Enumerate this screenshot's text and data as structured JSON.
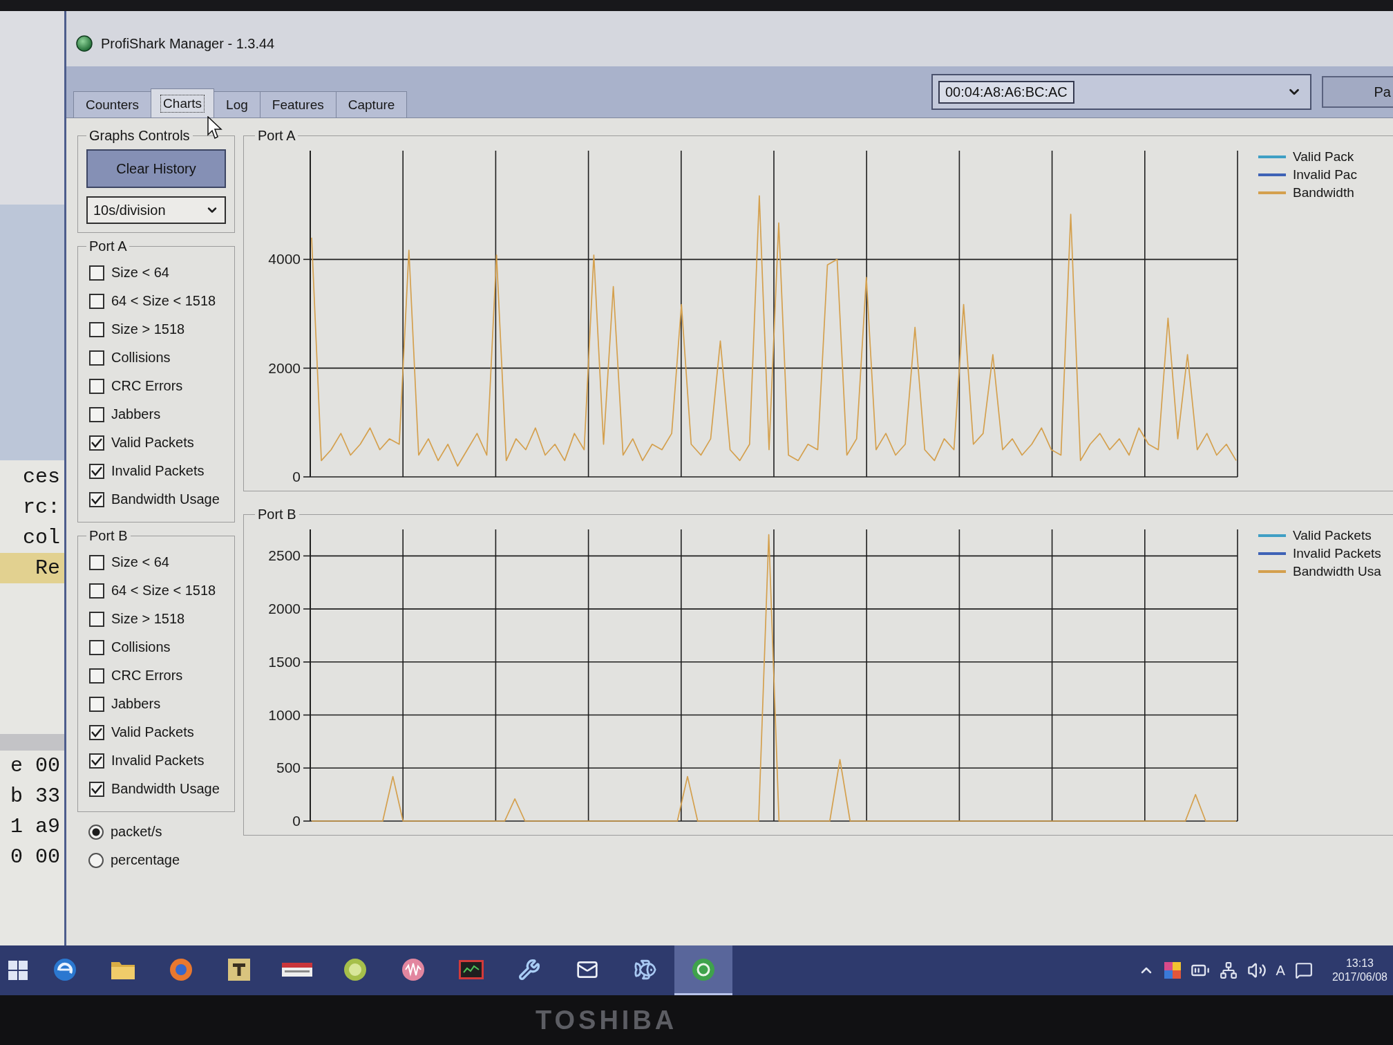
{
  "background_window": {
    "blocks": [
      {
        "lines": [
          {
            "text": "ces",
            "highlighted": false
          },
          {
            "text": "rc:",
            "highlighted": false
          },
          {
            "text": "col",
            "highlighted": false
          },
          {
            "text": "Re",
            "highlighted": true
          }
        ]
      },
      {
        "lines": [
          {
            "text": "e 00",
            "highlighted": false
          },
          {
            "text": "b 33",
            "highlighted": false
          },
          {
            "text": "1 a9",
            "highlighted": false
          },
          {
            "text": "0 00",
            "highlighted": false
          }
        ]
      }
    ]
  },
  "window": {
    "title": "ProfiShark Manager - 1.3.44"
  },
  "tabs": [
    {
      "label": "Counters",
      "selected": false
    },
    {
      "label": "Charts",
      "selected": true
    },
    {
      "label": "Log",
      "selected": false
    },
    {
      "label": "Features",
      "selected": false
    },
    {
      "label": "Capture",
      "selected": false
    }
  ],
  "device_select": {
    "value": "00:04:A8:A6:BC:AC"
  },
  "side_button": {
    "label": "Pa"
  },
  "graphs_controls": {
    "title": "Graphs Controls",
    "clear_button": "Clear History",
    "division_select": "10s/division",
    "port_groups": [
      {
        "title": "Port A",
        "options": [
          {
            "label": "Size < 64",
            "checked": false
          },
          {
            "label": "64 < Size < 1518",
            "checked": false
          },
          {
            "label": "Size > 1518",
            "checked": false
          },
          {
            "label": "Collisions",
            "checked": false
          },
          {
            "label": "CRC Errors",
            "checked": false
          },
          {
            "label": "Jabbers",
            "checked": false
          },
          {
            "label": "Valid Packets",
            "checked": true
          },
          {
            "label": "Invalid Packets",
            "checked": true
          },
          {
            "label": "Bandwidth Usage",
            "checked": true
          }
        ]
      },
      {
        "title": "Port B",
        "options": [
          {
            "label": "Size < 64",
            "checked": false
          },
          {
            "label": "64 < Size < 1518",
            "checked": false
          },
          {
            "label": "Size > 1518",
            "checked": false
          },
          {
            "label": "Collisions",
            "checked": false
          },
          {
            "label": "CRC Errors",
            "checked": false
          },
          {
            "label": "Jabbers",
            "checked": false
          },
          {
            "label": "Valid Packets",
            "checked": true
          },
          {
            "label": "Invalid Packets",
            "checked": true
          },
          {
            "label": "Bandwidth Usage",
            "checked": true
          }
        ]
      }
    ],
    "units": [
      {
        "label": "packet/s",
        "selected": true
      },
      {
        "label": "percentage",
        "selected": false
      }
    ]
  },
  "charts": [
    {
      "title": "Port A",
      "legend": [
        {
          "label": "Valid Pack",
          "color": "#3f9fc4"
        },
        {
          "label": "Invalid Pac",
          "color": "#3e62b6"
        },
        {
          "label": "Bandwidth",
          "color": "#d4a04e"
        }
      ],
      "chart_data": {
        "type": "line",
        "grid": true,
        "ylim": [
          0,
          6000
        ],
        "yticks": [
          0,
          2000,
          4000
        ],
        "series": [
          {
            "color": "#d4a04e",
            "values": [
              4400,
              300,
              500,
              800,
              400,
              600,
              900,
              500,
              700,
              600,
              4170,
              400,
              700,
              300,
              600,
              200,
              500,
              800,
              400,
              4080,
              300,
              700,
              500,
              900,
              400,
              600,
              300,
              800,
              500,
              4080,
              600,
              3500,
              400,
              700,
              300,
              600,
              500,
              800,
              3170,
              600,
              400,
              700,
              2500,
              500,
              300,
              600,
              5170,
              500,
              4670,
              400,
              300,
              600,
              500,
              3900,
              4000,
              400,
              700,
              3670,
              500,
              800,
              400,
              600,
              2750,
              500,
              300,
              700,
              500,
              3170,
              600,
              800,
              2250,
              500,
              700,
              400,
              600,
              900,
              500,
              400,
              4830,
              300,
              600,
              800,
              500,
              700,
              400,
              900,
              600,
              500,
              2920,
              700,
              2250,
              500,
              800,
              400,
              600,
              300
            ]
          }
        ]
      }
    },
    {
      "title": "Port B",
      "legend": [
        {
          "label": "Valid Packets",
          "color": "#3f9fc4"
        },
        {
          "label": "Invalid Packets",
          "color": "#3e62b6"
        },
        {
          "label": "Bandwidth Usa",
          "color": "#d4a04e"
        }
      ],
      "chart_data": {
        "type": "line",
        "grid": true,
        "ylim": [
          0,
          2750
        ],
        "yticks": [
          0,
          500,
          1000,
          1500,
          2000,
          2500
        ],
        "series": [
          {
            "color": "#d4a04e",
            "values": [
              0,
              0,
              0,
              0,
              0,
              0,
              0,
              0,
              420,
              0,
              0,
              0,
              0,
              0,
              0,
              0,
              0,
              0,
              0,
              0,
              210,
              0,
              0,
              0,
              0,
              0,
              0,
              0,
              0,
              0,
              0,
              0,
              0,
              0,
              0,
              0,
              0,
              420,
              0,
              0,
              0,
              0,
              0,
              0,
              0,
              2700,
              0,
              0,
              0,
              0,
              0,
              0,
              580,
              0,
              0,
              0,
              0,
              0,
              0,
              0,
              0,
              0,
              0,
              0,
              0,
              0,
              0,
              0,
              0,
              0,
              0,
              0,
              0,
              0,
              0,
              0,
              0,
              0,
              0,
              0,
              0,
              0,
              0,
              0,
              0,
              0,
              0,
              250,
              0,
              0,
              0,
              0
            ]
          }
        ]
      }
    }
  ],
  "taskbar": {
    "apps": [
      {
        "kind": "swirl",
        "active": false
      },
      {
        "kind": "folder",
        "active": false
      },
      {
        "kind": "globe",
        "active": false
      },
      {
        "kind": "t-tile",
        "active": false
      },
      {
        "kind": "banner",
        "active": false
      },
      {
        "kind": "disc",
        "active": false
      },
      {
        "kind": "waveform",
        "active": false
      },
      {
        "kind": "monitor",
        "active": false
      },
      {
        "kind": "wrench",
        "active": false
      },
      {
        "kind": "envelope",
        "active": false
      },
      {
        "kind": "fish",
        "active": false
      },
      {
        "kind": "ring",
        "active": true
      }
    ],
    "ime": "A",
    "time": "13:13",
    "date": "2017/06/08"
  },
  "bezel": {
    "brand": "TOSHIBA"
  }
}
